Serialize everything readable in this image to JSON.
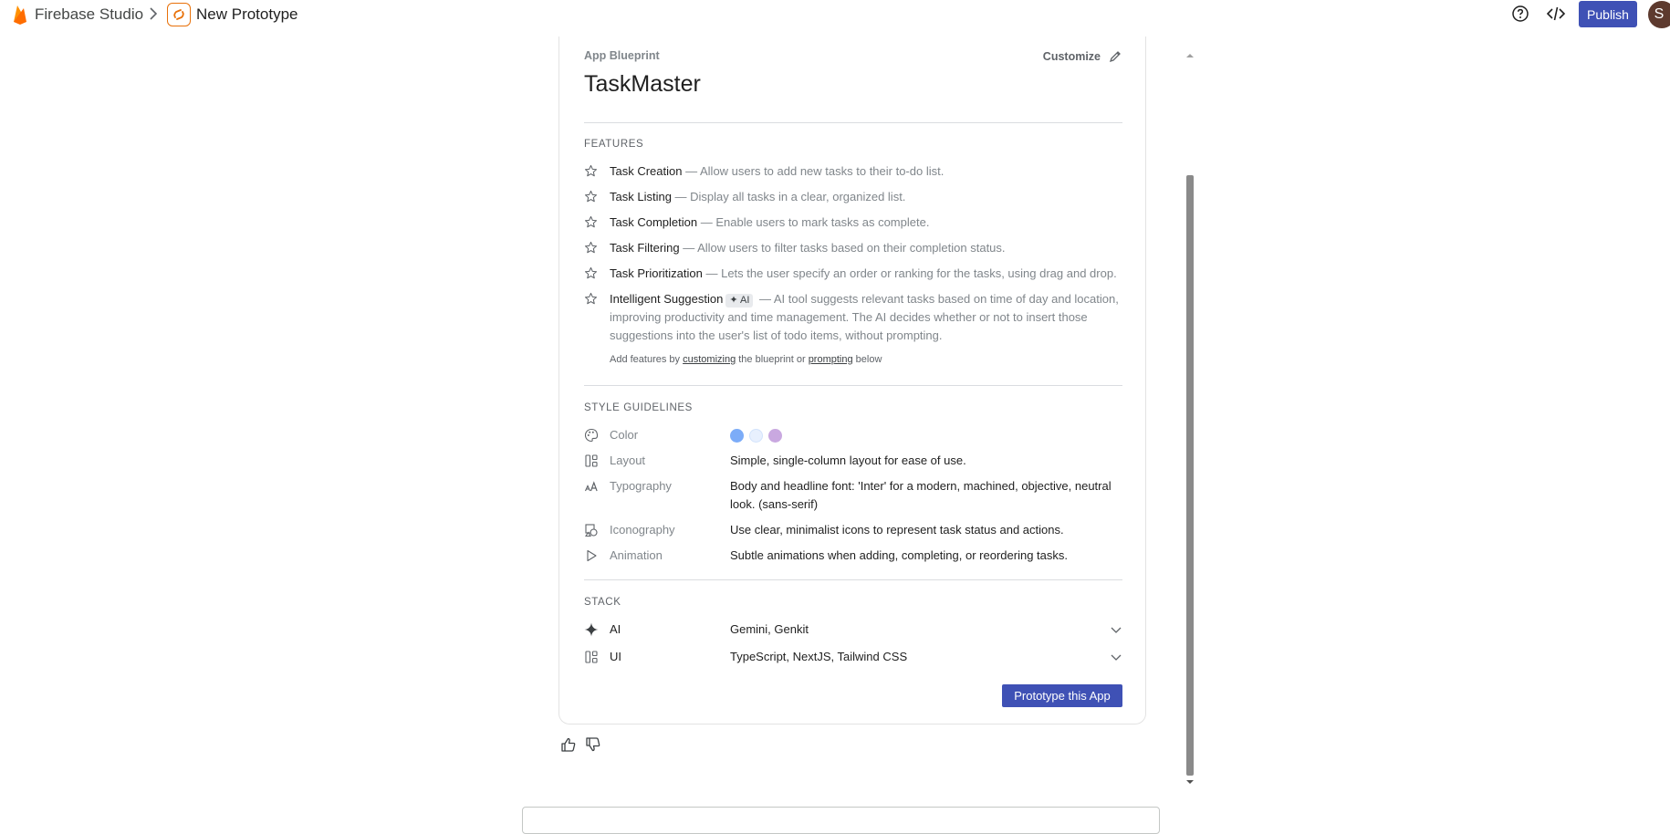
{
  "topbar": {
    "brand": "Firebase Studio",
    "project": "New Prototype",
    "publish_label": "Publish",
    "avatar_initial": "S"
  },
  "blueprint": {
    "label": "App Blueprint",
    "customize_label": "Customize",
    "app_name": "TaskMaster"
  },
  "features": {
    "title": "FEATURES",
    "items": [
      {
        "name": "Task Creation",
        "desc": " — Allow users to add new tasks to their to-do list."
      },
      {
        "name": "Task Listing",
        "desc": " — Display all tasks in a clear, organized list."
      },
      {
        "name": "Task Completion",
        "desc": " — Enable users to mark tasks as complete."
      },
      {
        "name": "Task Filtering",
        "desc": " — Allow users to filter tasks based on their completion status."
      },
      {
        "name": "Task Prioritization",
        "desc": " — Lets the user specify an order or ranking for the tasks, using drag and drop."
      },
      {
        "name": "Intelligent Suggestion",
        "badge": "✦ AI",
        "desc": " — AI tool suggests relevant tasks based on time of day and location, improving productivity and time management. The AI decides whether or not to insert those suggestions into the user's list of todo items, without prompting."
      }
    ],
    "hint": {
      "prefix": "Add features by ",
      "link1": "customizing",
      "middle": " the blueprint or ",
      "link2": "prompting",
      "suffix": " below"
    }
  },
  "style": {
    "title": "STYLE GUIDELINES",
    "color_label": "Color",
    "colors": [
      "#7cacf8",
      "#e8f0fe",
      "#c9a8e0"
    ],
    "rows": [
      {
        "label": "Layout",
        "value": "Simple, single-column layout for ease of use."
      },
      {
        "label": "Typography",
        "value": "Body and headline font: 'Inter' for a modern, machined, objective, neutral look. (sans-serif)"
      },
      {
        "label": "Iconography",
        "value": "Use clear, minimalist icons to represent task status and actions."
      },
      {
        "label": "Animation",
        "value": "Subtle animations when adding, completing, or reordering tasks."
      }
    ]
  },
  "stack": {
    "title": "STACK",
    "rows": [
      {
        "label": "AI",
        "value": "Gemini, Genkit"
      },
      {
        "label": "UI",
        "value": "TypeScript, NextJS, Tailwind CSS"
      }
    ]
  },
  "actions": {
    "prototype_label": "Prototype this App"
  }
}
